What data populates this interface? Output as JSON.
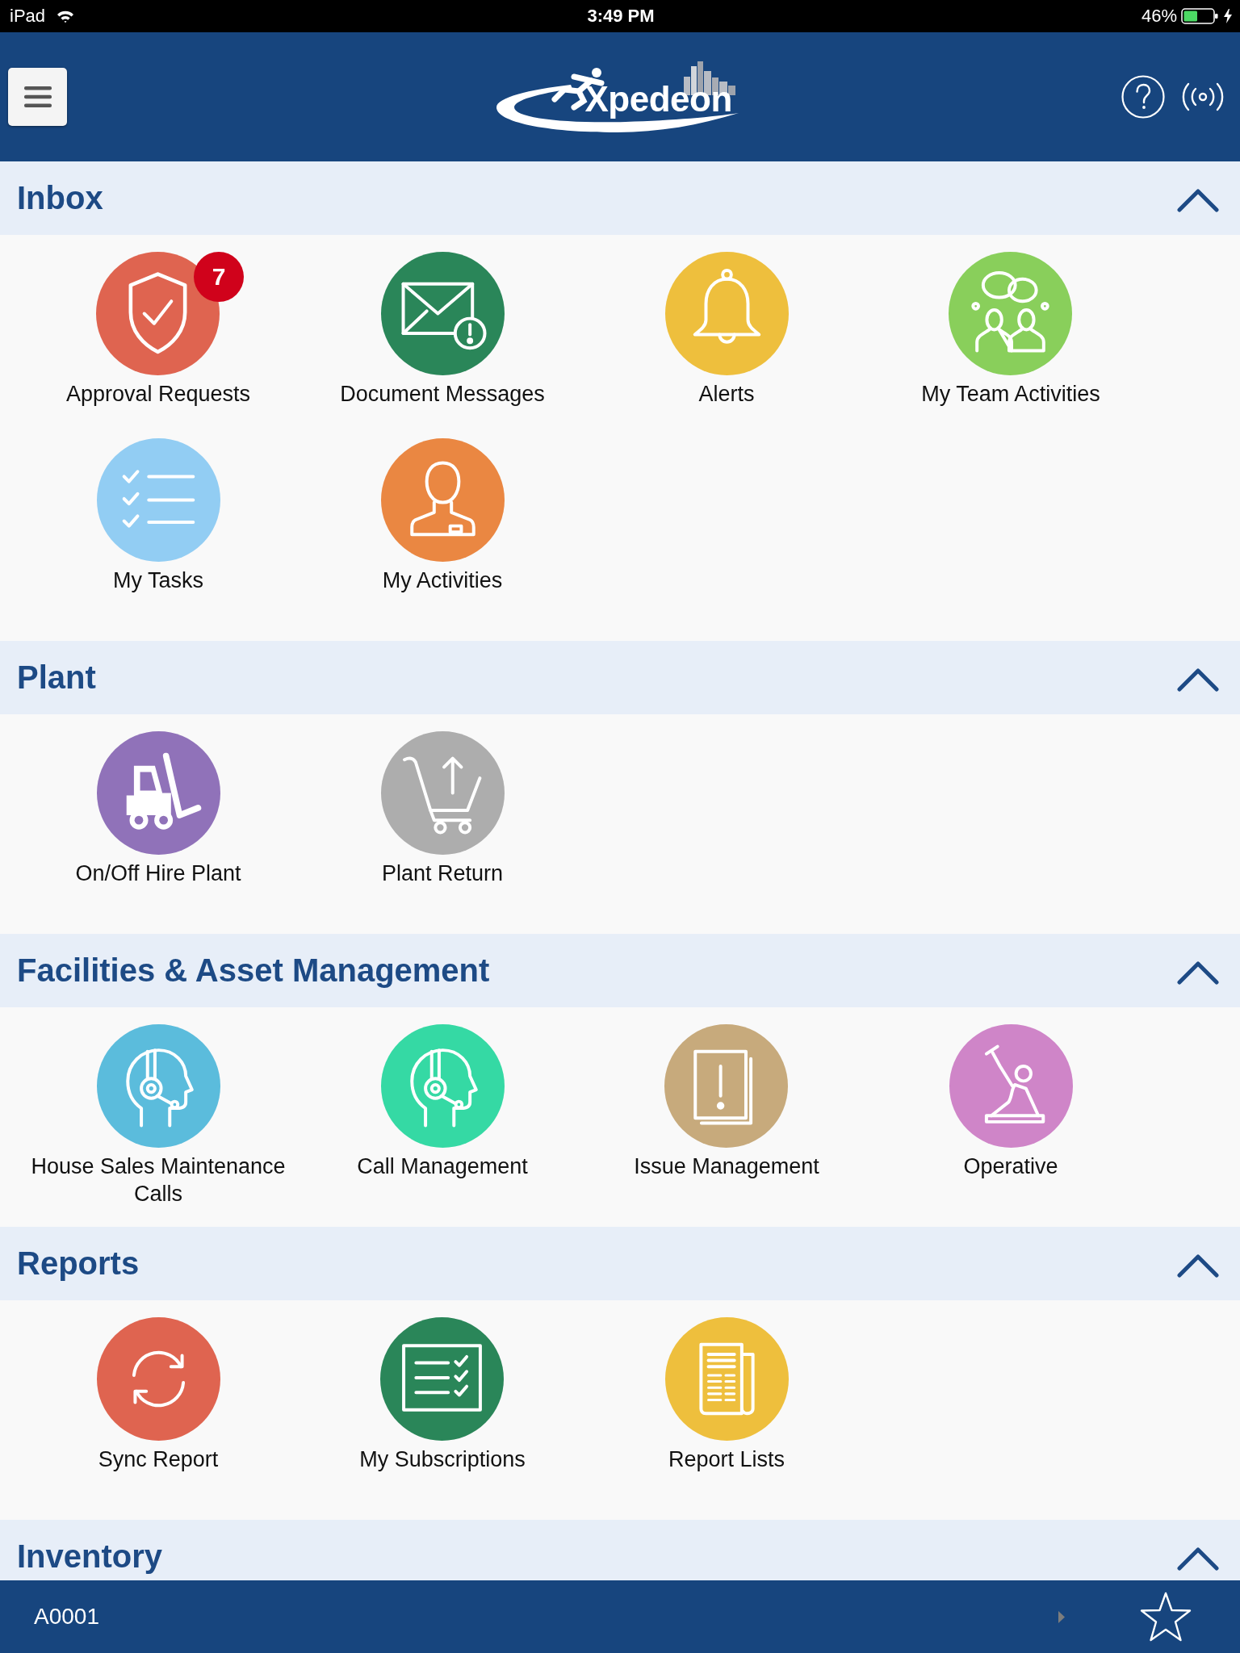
{
  "status_bar": {
    "carrier": "iPad",
    "time": "3:49 PM",
    "battery": "46%"
  },
  "header": {
    "logo_text": "Xpedeon"
  },
  "sections": [
    {
      "title": "Inbox",
      "expanded": true,
      "items": [
        {
          "label": "Approval Requests",
          "kind": "shield",
          "color": "#df6450",
          "badge": "7"
        },
        {
          "label": "Document Messages",
          "kind": "envelope",
          "color": "#2a8659"
        },
        {
          "label": "Alerts",
          "kind": "bell",
          "color": "#eebf3d"
        },
        {
          "label": "My Team Activities",
          "kind": "team",
          "color": "#89cf5b"
        },
        {
          "label": "My Tasks",
          "kind": "checklist",
          "color": "#92cdf3"
        },
        {
          "label": "My Activities",
          "kind": "person",
          "color": "#ea8742"
        }
      ]
    },
    {
      "title": "Plant",
      "expanded": true,
      "items": [
        {
          "label": "On/Off Hire Plant",
          "kind": "forklift",
          "color": "#9072b9"
        },
        {
          "label": "Plant Return",
          "kind": "cart",
          "color": "#adadad"
        }
      ]
    },
    {
      "title": "Facilities & Asset Management",
      "expanded": true,
      "items": [
        {
          "label": "House Sales Maintenance Calls",
          "kind": "headset",
          "color": "#5bbcdc"
        },
        {
          "label": "Call Management",
          "kind": "headset",
          "color": "#35d9a4"
        },
        {
          "label": "Issue Management",
          "kind": "document",
          "color": "#c7aa7c"
        },
        {
          "label": "Operative",
          "kind": "worker",
          "color": "#cf85c8"
        }
      ]
    },
    {
      "title": "Reports",
      "expanded": true,
      "items": [
        {
          "label": "Sync Report",
          "kind": "sync",
          "color": "#df6450"
        },
        {
          "label": "My Subscriptions",
          "kind": "subscriptions",
          "color": "#2a8659"
        },
        {
          "label": "Report Lists",
          "kind": "newspaper",
          "color": "#eebf3d"
        }
      ]
    },
    {
      "title": "Inventory",
      "expanded": true
    }
  ],
  "bottom_bar": {
    "code": "A0001"
  }
}
